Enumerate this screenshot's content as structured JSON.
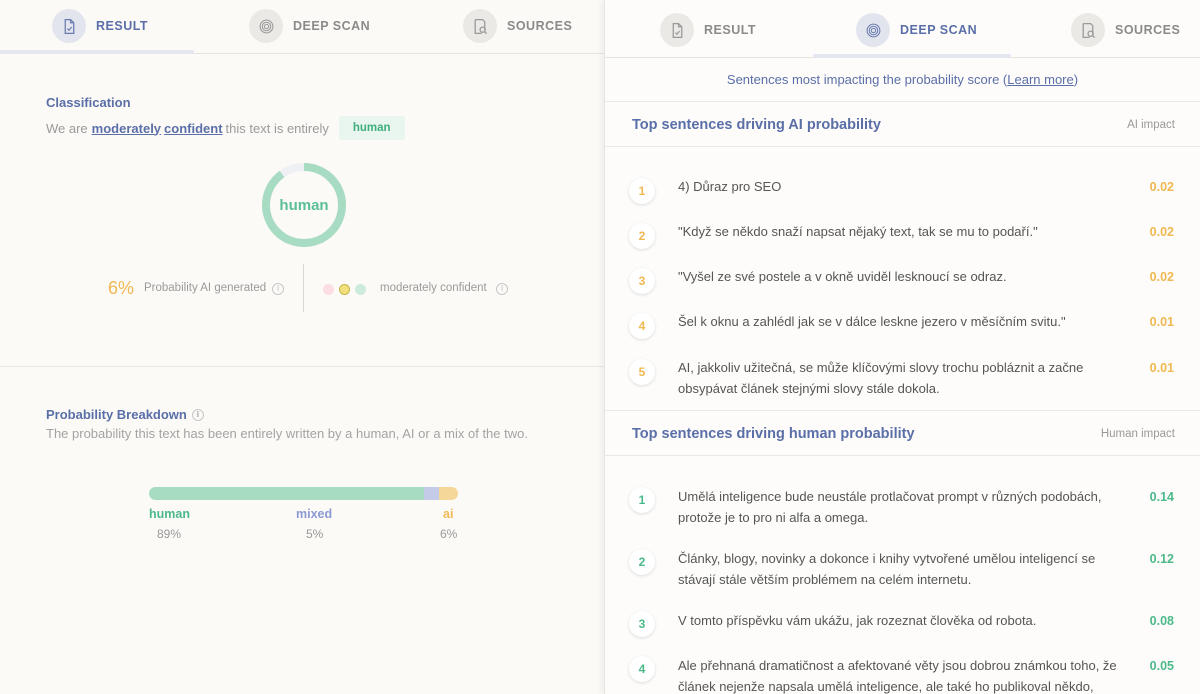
{
  "left": {
    "tabs": [
      {
        "label": "RESULT",
        "active": true,
        "icon": "document-icon"
      },
      {
        "label": "DEEP SCAN",
        "active": false,
        "icon": "fingerprint-icon"
      },
      {
        "label": "SOURCES",
        "active": false,
        "icon": "search-document-icon"
      }
    ],
    "classification": {
      "title": "Classification",
      "sub_prefix": "We are",
      "sub_word1": "moderately",
      "sub_word2": "confident",
      "sub_suffix": "this text is entirely",
      "badge": "human",
      "donut_label": "human"
    },
    "probability": {
      "percent": "6%",
      "label": "Probability AI generated",
      "confidence_label": "moderately confident"
    },
    "breakdown": {
      "title": "Probability Breakdown",
      "subtitle": "The probability this text has been entirely written by a human, AI or a mix of the two.",
      "items": [
        {
          "label": "human",
          "pct": "89%",
          "value": 0.89
        },
        {
          "label": "mixed",
          "pct": "5%",
          "value": 0.05
        },
        {
          "label": "ai",
          "pct": "6%",
          "value": 0.06
        }
      ]
    }
  },
  "right": {
    "tabs": [
      {
        "label": "RESULT",
        "active": false,
        "icon": "document-icon"
      },
      {
        "label": "DEEP SCAN",
        "active": true,
        "icon": "fingerprint-icon"
      },
      {
        "label": "SOURCES",
        "active": false,
        "icon": "search-document-icon"
      }
    ],
    "header_text": "Sentences most impacting the probability score (",
    "header_link": "Learn more",
    "header_end": ")",
    "ai_section": {
      "title": "Top sentences driving AI probability",
      "impact_label": "AI impact",
      "sentences": [
        {
          "num": "1",
          "text": "4) Důraz pro SEO",
          "value": "0.02"
        },
        {
          "num": "2",
          "text": "\"Když se někdo snaží napsat nějaký text, tak se mu to podaří.\"",
          "value": "0.02"
        },
        {
          "num": "3",
          "text": "\"Vyšel ze své postele a v okně uviděl lesknoucí se odraz.",
          "value": "0.02"
        },
        {
          "num": "4",
          "text": "Šel k oknu a zahlédl jak se v dálce leskne jezero v měsíčním svitu.\"",
          "value": "0.01"
        },
        {
          "num": "5",
          "text": "AI, jakkoliv užitečná, se může klíčovými slovy trochu pobláznit a začne obsypávat článek stejnými slovy stále dokola.",
          "value": "0.01"
        }
      ]
    },
    "human_section": {
      "title": "Top sentences driving human probability",
      "impact_label": "Human impact",
      "sentences": [
        {
          "num": "1",
          "text": "Umělá inteligence bude neustále protlačovat prompt v různých podobách, protože je to pro ni alfa a omega.",
          "value": "0.14"
        },
        {
          "num": "2",
          "text": "Články, blogy, novinky a dokonce i knihy vytvořené umělou inteligencí se stávají stále větším problémem na celém internetu.",
          "value": "0.12"
        },
        {
          "num": "3",
          "text": "V tomto příspěvku vám ukážu, jak rozeznat člověka od robota.",
          "value": "0.08"
        },
        {
          "num": "4",
          "text": "Ale přehnaná dramatičnost a afektované věty jsou dobrou známkou toho, že článek nejenže napsala umělá inteligence, ale také ho publikoval někdo,",
          "value": "0.05"
        }
      ]
    }
  },
  "colors": {
    "human": "#a7dcc2",
    "mixed": "#c4cbe8",
    "ai": "#f6d79a",
    "accent": "#5a6fa8",
    "dot_pink": "#fbdde3",
    "dot_yellow": "#f2e07c",
    "dot_green": "#cdebdc"
  }
}
